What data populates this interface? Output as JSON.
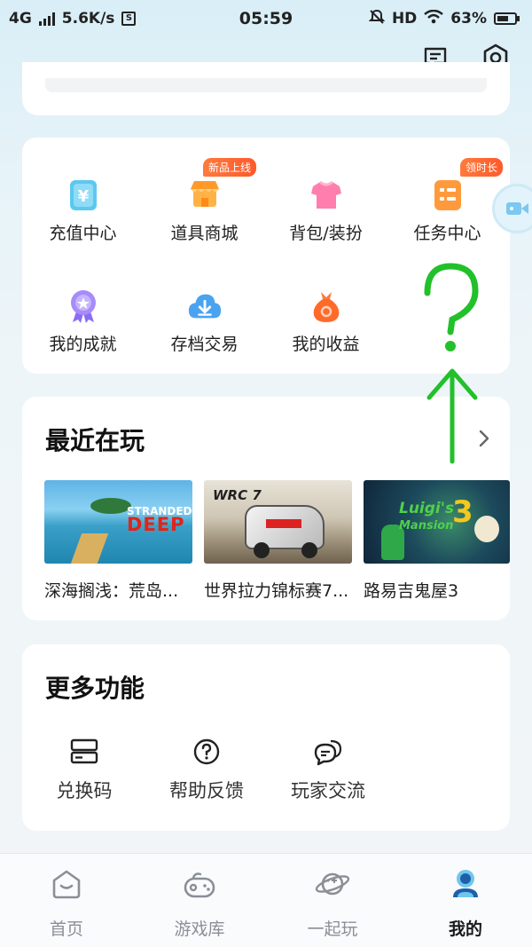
{
  "status_bar": {
    "network": "4G",
    "speed": "5.6K/s",
    "s_icon": "S",
    "time": "05:59",
    "hd": "HD",
    "battery": "63%"
  },
  "header": {
    "icons": [
      "message-icon",
      "settings-icon"
    ]
  },
  "grid": {
    "items": [
      {
        "label": "充值中心",
        "icon": "recharge-icon",
        "tag": ""
      },
      {
        "label": "道具商城",
        "icon": "shop-icon",
        "tag": "新品上线"
      },
      {
        "label": "背包/装扮",
        "icon": "backpack-icon",
        "tag": ""
      },
      {
        "label": "任务中心",
        "icon": "task-icon",
        "tag": "领时长"
      },
      {
        "label": "我的成就",
        "icon": "achievement-icon",
        "tag": ""
      },
      {
        "label": "存档交易",
        "icon": "save-trade-icon",
        "tag": ""
      },
      {
        "label": "我的收益",
        "icon": "earnings-icon",
        "tag": ""
      }
    ]
  },
  "recent": {
    "title": "最近在玩",
    "games": [
      {
        "name": "深海搁浅：荒岛...",
        "thumb_text_1": "STRANDED",
        "thumb_text_2": "DEEP"
      },
      {
        "name": "世界拉力锦标赛7...",
        "thumb_text_1": "WRC 7",
        "thumb_text_2": ""
      },
      {
        "name": "路易吉鬼屋3",
        "thumb_text_1": "Luigi's",
        "thumb_text_2": "Mansion"
      }
    ]
  },
  "more": {
    "title": "更多功能",
    "items": [
      {
        "label": "兑换码",
        "icon": "redeem-code-icon"
      },
      {
        "label": "帮助反馈",
        "icon": "help-icon"
      },
      {
        "label": "玩家交流",
        "icon": "chat-icon"
      }
    ]
  },
  "annotation": {
    "symbol": "?"
  },
  "tabs": [
    {
      "label": "首页",
      "icon": "home-icon",
      "active": false
    },
    {
      "label": "游戏库",
      "icon": "gamepad-icon",
      "active": false
    },
    {
      "label": "一起玩",
      "icon": "planet-icon",
      "active": false
    },
    {
      "label": "我的",
      "icon": "profile-icon",
      "active": true
    }
  ],
  "colors": {
    "accent_orange": "#ff5a2a",
    "annotation_green": "#22c02a",
    "tab_active": "#1a1a1a",
    "tab_inactive": "#8a8f96"
  }
}
